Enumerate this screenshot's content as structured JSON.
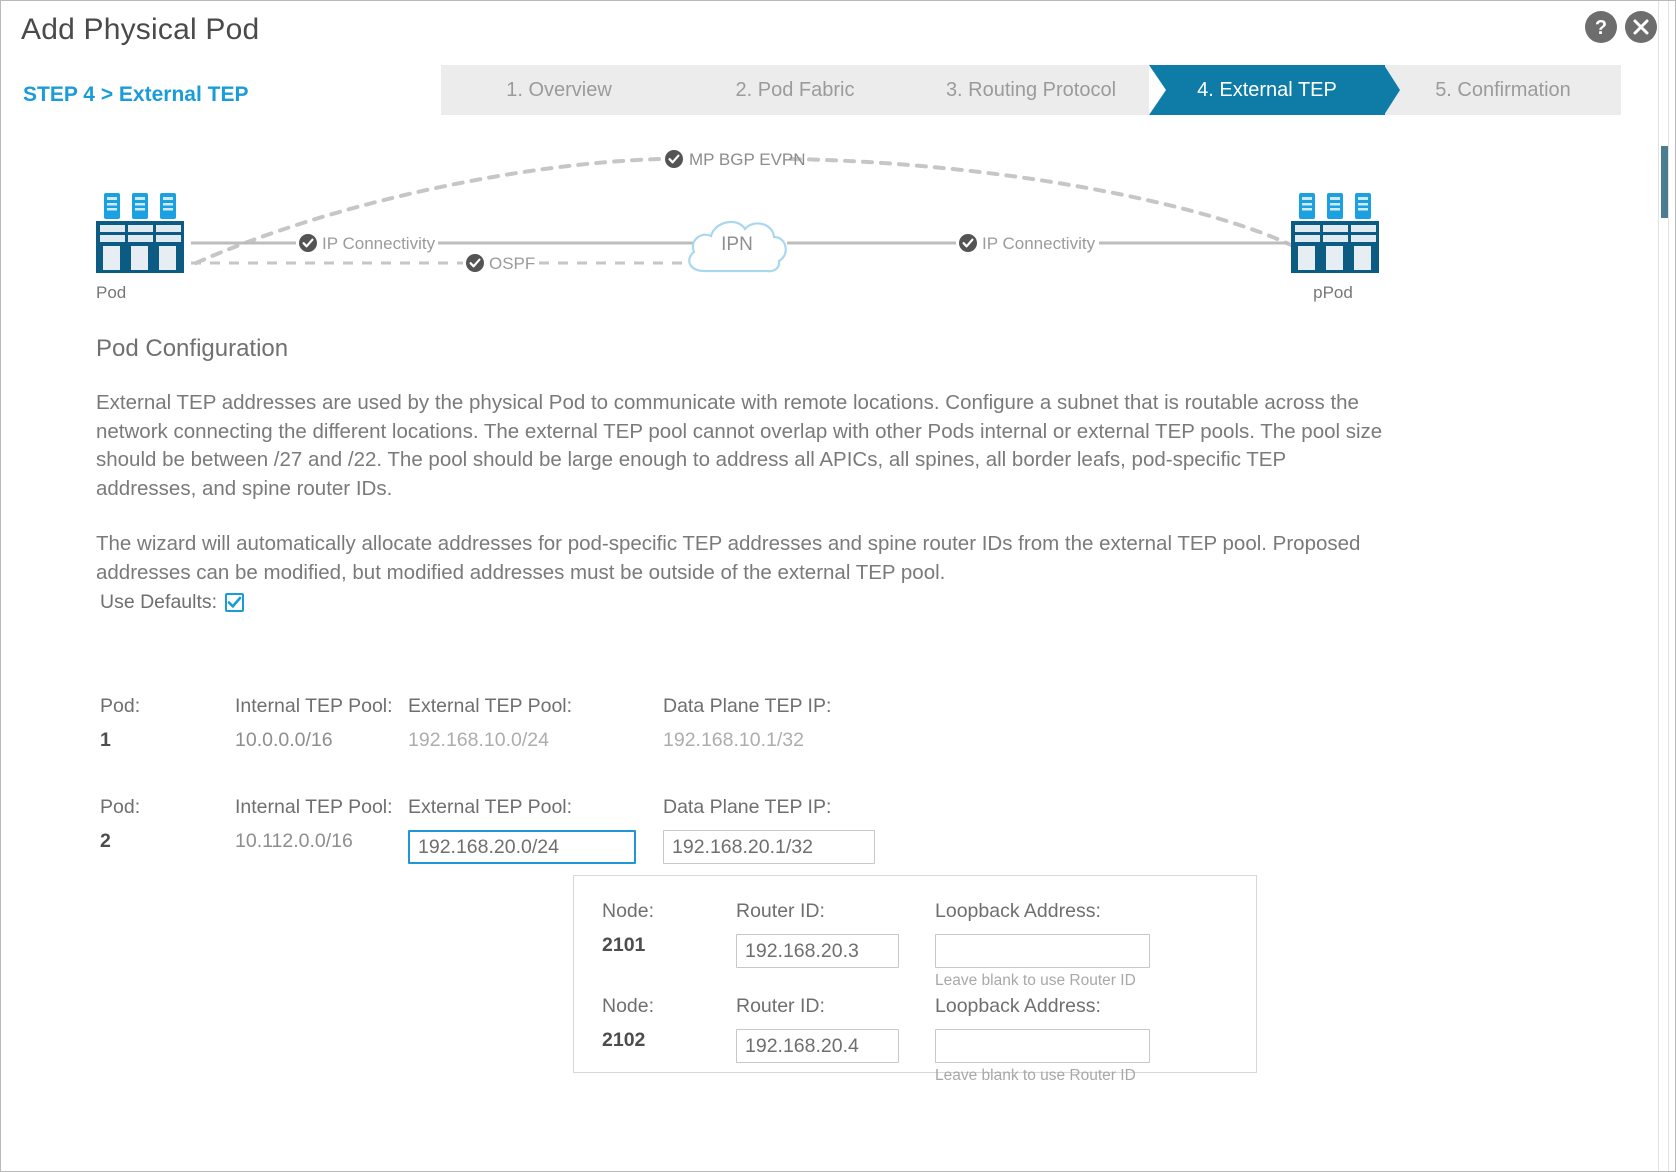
{
  "window": {
    "title": "Add Physical Pod",
    "help_icon": "question-mark-icon",
    "close_icon": "close-icon"
  },
  "breadcrumb": "STEP 4 > External TEP",
  "steps": [
    {
      "label": "1. Overview",
      "active": false
    },
    {
      "label": "2. Pod Fabric",
      "active": false
    },
    {
      "label": "3. Routing Protocol",
      "active": false
    },
    {
      "label": "4. External TEP",
      "active": true
    },
    {
      "label": "5. Confirmation",
      "active": false
    }
  ],
  "diagram": {
    "left_node_label": "Pod",
    "right_node_label": "pPod",
    "cloud_label": "IPN",
    "links": [
      {
        "label": "MP BGP EVPN",
        "style": "dashed"
      },
      {
        "label": "IP Connectivity",
        "style": "solid"
      },
      {
        "label": "OSPF",
        "style": "dashed"
      },
      {
        "label": "IP Connectivity",
        "style": "solid"
      }
    ],
    "badge_icon": "check-badge-icon"
  },
  "content": {
    "section_title": "Pod Configuration",
    "paragraph_1": "External TEP addresses are used by the physical Pod to communicate with remote locations. Configure a subnet that is routable across the network connecting the different locations. The external TEP pool cannot overlap with other Pods internal or external TEP pools. The pool size should be between /27 and /22. The pool should be large enough to address all APICs, all spines, all border leafs, pod-specific TEP addresses, and spine router IDs.",
    "paragraph_2": "The wizard will automatically allocate addresses for pod-specific TEP addresses and spine router IDs from the external TEP pool. Proposed addresses can be modified, but modified addresses must be outside of the external TEP pool.",
    "use_defaults_label": "Use Defaults:",
    "use_defaults_checked": true,
    "check_icon": "checkmark-icon"
  },
  "headers": {
    "pod": "Pod:",
    "internal_tep_pool": "Internal TEP Pool:",
    "external_tep_pool": "External TEP Pool:",
    "data_plane_tep_ip": "Data Plane TEP IP:",
    "node": "Node:",
    "router_id": "Router ID:",
    "loopback_address": "Loopback Address:"
  },
  "pods": [
    {
      "pod": "1",
      "internal_tep_pool": "10.0.0.0/16",
      "external_tep_pool": "192.168.10.0/24",
      "data_plane_tep_ip": "192.168.10.1/32",
      "editable": false
    },
    {
      "pod": "2",
      "internal_tep_pool": "10.112.0.0/16",
      "external_tep_pool": "192.168.20.0/24",
      "data_plane_tep_ip": "192.168.20.1/32",
      "editable": true
    }
  ],
  "nodes": [
    {
      "node": "2101",
      "router_id": "192.168.20.3",
      "loopback_address": "",
      "loopback_hint": "Leave blank to use Router ID"
    },
    {
      "node": "2102",
      "router_id": "192.168.20.4",
      "loopback_address": "",
      "loopback_hint": "Leave blank to use Router ID"
    }
  ],
  "colors": {
    "accent": "#1a9cd8",
    "active_step": "#0f7ca8",
    "pod_icon": "#0c5b82",
    "pod_icon_light": "#1ba0e2",
    "scrollbar_thumb": "#4a7d91"
  }
}
